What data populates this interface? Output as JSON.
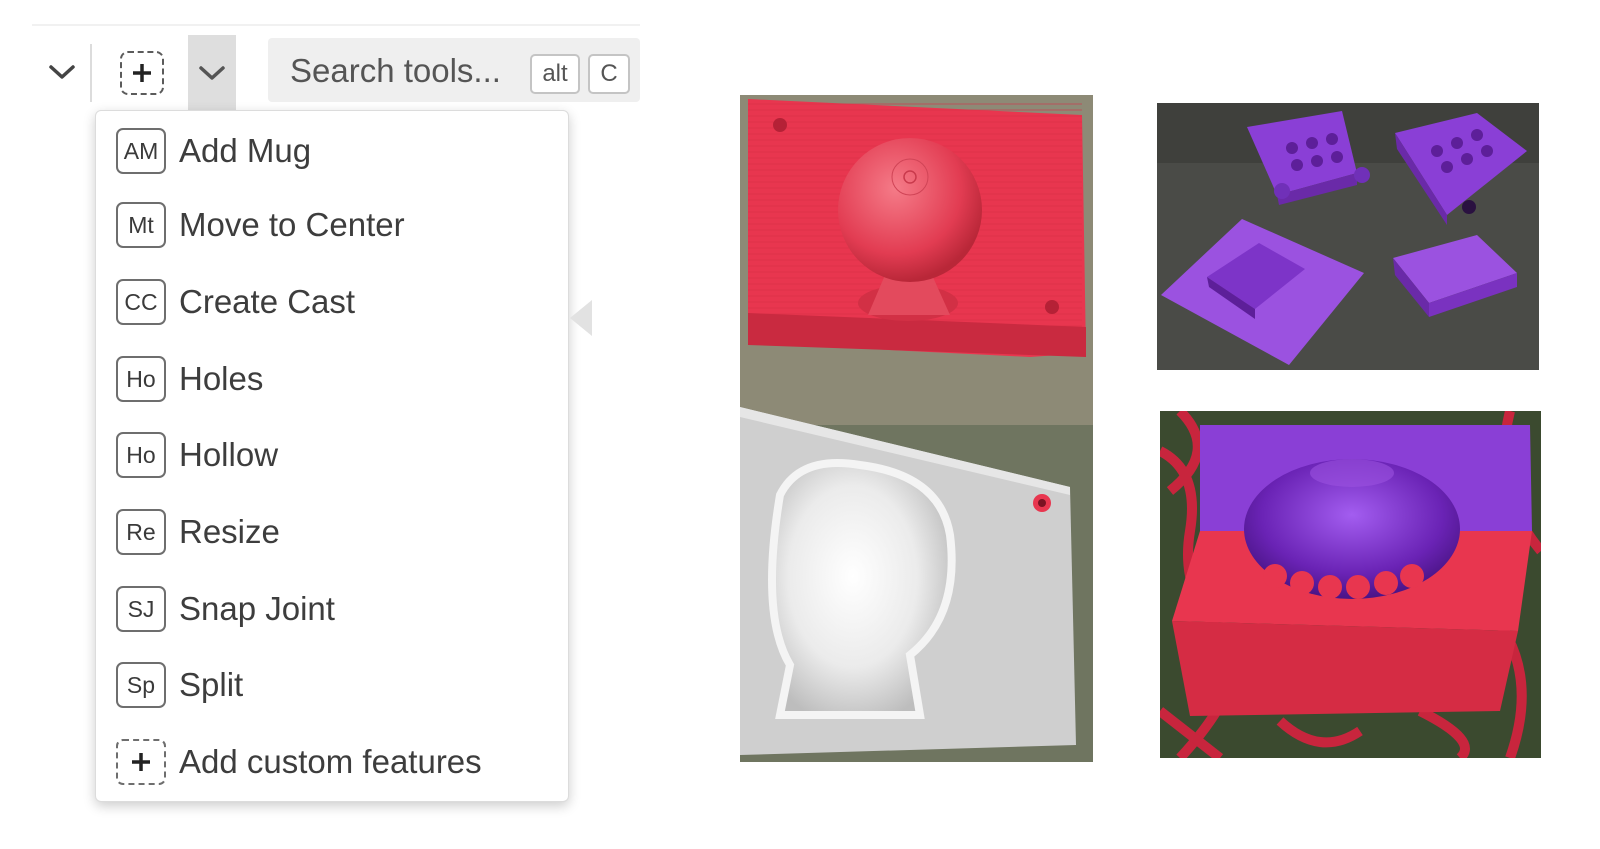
{
  "toolbar": {
    "collapse_icon": "chevron-down-icon",
    "add_feature_icon": "plus-dashed-icon",
    "dropdown_icon": "chevron-down-icon",
    "search": {
      "placeholder": "Search tools...",
      "shortcut_keys": [
        "alt",
        "C"
      ]
    }
  },
  "menu": {
    "items": [
      {
        "abbr": "AM",
        "label": "Add Mug"
      },
      {
        "abbr": "Mt",
        "label": "Move to Center"
      },
      {
        "abbr": "CC",
        "label": "Create Cast"
      },
      {
        "abbr": "Ho",
        "label": "Holes"
      },
      {
        "abbr": "Ho",
        "label": "Hollow"
      },
      {
        "abbr": "Re",
        "label": "Resize"
      },
      {
        "abbr": "SJ",
        "label": "Snap Joint"
      },
      {
        "abbr": "Sp",
        "label": "Split"
      }
    ],
    "add_custom": {
      "icon": "plus-dashed-icon",
      "label": "Add custom features"
    }
  },
  "colors": {
    "print_red": "#e8364f",
    "print_purple": "#8a3fd6",
    "print_white": "#dcdcdc",
    "table_gray": "#4a4b47",
    "fabric_green": "#6f7560"
  }
}
